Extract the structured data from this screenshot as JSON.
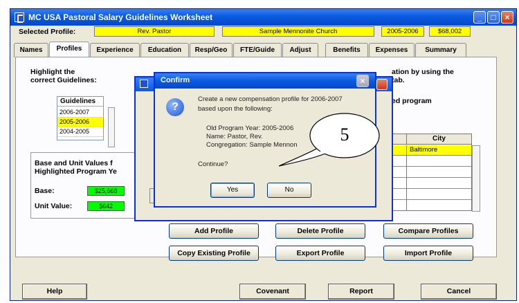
{
  "window": {
    "title": "MC USA Pastoral Salary Guidelines Worksheet",
    "controls": [
      "_",
      "□",
      "×"
    ]
  },
  "header": {
    "selected_profile_label": "Selected Profile:",
    "profile_name": "Rev. Pastor",
    "church": "Sample Mennonite Church",
    "year": "2005-2006",
    "amount": "$68,002"
  },
  "tabs": [
    "Names",
    "Profiles",
    "Experience",
    "Education",
    "Resp/Geo",
    "FTE/Guide",
    "Adjust",
    "Benefits",
    "Expenses",
    "Summary"
  ],
  "active_tab": "Profiles",
  "profiles_panel": {
    "instruction": [
      "Highlight the",
      "correct Guidelines:"
    ],
    "right_instruction": [
      "ation by using the",
      "tab."
    ],
    "right_label": "ed program",
    "guidelines_header": "Guidelines",
    "guidelines": [
      "2006-2007",
      "2005-2006",
      "2004-2005"
    ],
    "selected_guideline": "2005-2006",
    "base_unit_heading": [
      "Base and Unit Values f",
      "Highlighted Program Ye"
    ],
    "base_label": "Base:",
    "base_value": "$25,668",
    "unit_label": "Unit Value:",
    "unit_value": "$642",
    "city_header": "City",
    "city_first_row": "Baltimore"
  },
  "profile_buttons": {
    "add": "Add Profile",
    "delete": "Delete Profile",
    "compare": "Compare Profiles",
    "copy": "Copy Existing Profile",
    "export": "Export Profile",
    "import": "Import Profile"
  },
  "footer_buttons": {
    "help": "Help",
    "covenant": "Covenant",
    "report": "Report",
    "cancel": "Cancel"
  },
  "dialog": {
    "title": "Confirm",
    "line1": "Create a new compensation profile for 2006-2007",
    "line2": "based upon the following:",
    "old_year": "Old Program Year:  2005-2006",
    "name": "Name: Pastor, Rev.",
    "congregation": "Congregation: Sample Mennon",
    "question": "Continue?",
    "yes": "Yes",
    "no": "No"
  },
  "callout": {
    "number": "5"
  },
  "colors": {
    "highlight": "#ffff00",
    "value_green": "#00ff00",
    "xp_blue": "#0a5ae0"
  }
}
